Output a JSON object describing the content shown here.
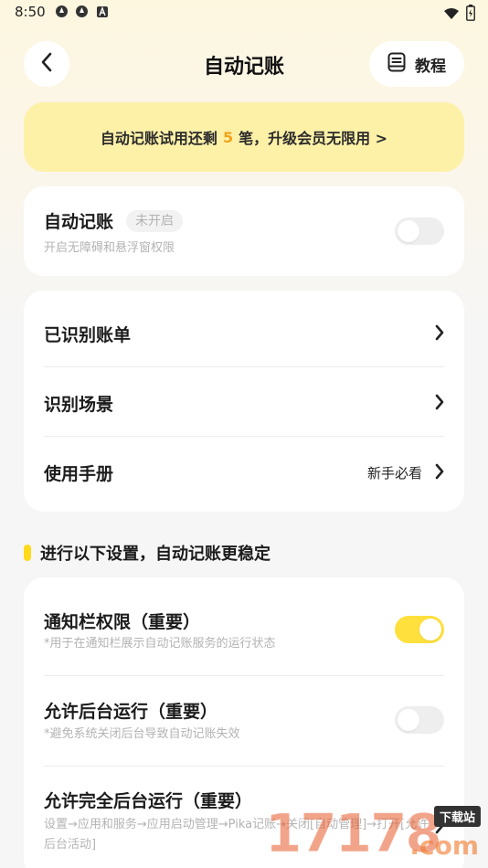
{
  "status_bar": {
    "time": "8:50",
    "left_icons": [
      "app-icon-1",
      "app-icon-2",
      "app-icon-a"
    ],
    "right_icons": [
      "wifi-icon",
      "battery-icon"
    ]
  },
  "header": {
    "title": "自动记账",
    "tutorial_label": "教程"
  },
  "banner": {
    "prefix": "自动记账试用还剩",
    "count": "5",
    "suffix": "笔，升级会员无限用 >"
  },
  "auto_card": {
    "title": "自动记账",
    "status": "未开启",
    "subtitle": "开启无障碍和悬浮窗权限",
    "enabled": false
  },
  "menu": {
    "items": [
      {
        "label": "已识别账单",
        "hint": ""
      },
      {
        "label": "识别场景",
        "hint": ""
      },
      {
        "label": "使用手册",
        "hint": "新手必看"
      }
    ]
  },
  "section": {
    "title": "进行以下设置，自动记账更稳定"
  },
  "settings": {
    "items": [
      {
        "title": "通知栏权限（重要）",
        "subtitle": "*用于在通知栏展示自动记账服务的运行状态",
        "enabled": true
      },
      {
        "title": "允许后台运行（重要）",
        "subtitle": "*避免系统关闭后台导致自动记账失效",
        "enabled": false
      },
      {
        "title": "允许完全后台运行（重要）",
        "subtitle": "设置→应用和服务→应用启动管理→Pika记账→关闭[自动管理]→打开[允许后台活动]"
      }
    ]
  },
  "watermark": {
    "digits": "17178",
    "badge": "下载站",
    "suffix": ".com"
  },
  "colors": {
    "accent_yellow": "#ffe03d",
    "banner_bg": "#fdf1a8",
    "count_orange": "#f2a21a"
  }
}
